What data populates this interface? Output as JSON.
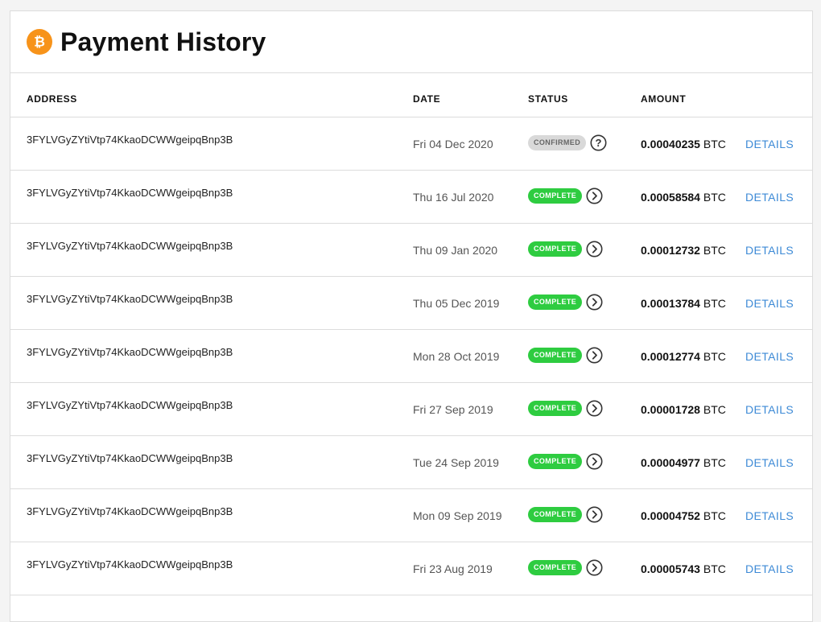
{
  "header": {
    "title": "Payment History",
    "logo_icon": "bitcoin-icon",
    "logo_color": "#f7931a"
  },
  "table": {
    "columns": {
      "address": "ADDRESS",
      "date": "DATE",
      "status": "STATUS",
      "amount": "AMOUNT"
    },
    "details_label": "DETAILS",
    "rows": [
      {
        "address": "3FYLVGyZYtiVtp74KkaoDCWWgeipqBnp3B",
        "date": "Fri 04 Dec 2020",
        "status": "CONFIRMED",
        "status_type": "confirmed",
        "status_icon": "question-circle-icon",
        "amount": "0.00040235",
        "currency": "BTC"
      },
      {
        "address": "3FYLVGyZYtiVtp74KkaoDCWWgeipqBnp3B",
        "date": "Thu 16 Jul 2020",
        "status": "COMPLETE",
        "status_type": "complete",
        "status_icon": "chevron-right-circle-icon",
        "amount": "0.00058584",
        "currency": "BTC"
      },
      {
        "address": "3FYLVGyZYtiVtp74KkaoDCWWgeipqBnp3B",
        "date": "Thu 09 Jan 2020",
        "status": "COMPLETE",
        "status_type": "complete",
        "status_icon": "chevron-right-circle-icon",
        "amount": "0.00012732",
        "currency": "BTC"
      },
      {
        "address": "3FYLVGyZYtiVtp74KkaoDCWWgeipqBnp3B",
        "date": "Thu 05 Dec 2019",
        "status": "COMPLETE",
        "status_type": "complete",
        "status_icon": "chevron-right-circle-icon",
        "amount": "0.00013784",
        "currency": "BTC"
      },
      {
        "address": "3FYLVGyZYtiVtp74KkaoDCWWgeipqBnp3B",
        "date": "Mon 28 Oct 2019",
        "status": "COMPLETE",
        "status_type": "complete",
        "status_icon": "chevron-right-circle-icon",
        "amount": "0.00012774",
        "currency": "BTC"
      },
      {
        "address": "3FYLVGyZYtiVtp74KkaoDCWWgeipqBnp3B",
        "date": "Fri 27 Sep 2019",
        "status": "COMPLETE",
        "status_type": "complete",
        "status_icon": "chevron-right-circle-icon",
        "amount": "0.00001728",
        "currency": "BTC"
      },
      {
        "address": "3FYLVGyZYtiVtp74KkaoDCWWgeipqBnp3B",
        "date": "Tue 24 Sep 2019",
        "status": "COMPLETE",
        "status_type": "complete",
        "status_icon": "chevron-right-circle-icon",
        "amount": "0.00004977",
        "currency": "BTC"
      },
      {
        "address": "3FYLVGyZYtiVtp74KkaoDCWWgeipqBnp3B",
        "date": "Mon 09 Sep 2019",
        "status": "COMPLETE",
        "status_type": "complete",
        "status_icon": "chevron-right-circle-icon",
        "amount": "0.00004752",
        "currency": "BTC"
      },
      {
        "address": "3FYLVGyZYtiVtp74KkaoDCWWgeipqBnp3B",
        "date": "Fri 23 Aug 2019",
        "status": "COMPLETE",
        "status_type": "complete",
        "status_icon": "chevron-right-circle-icon",
        "amount": "0.00005743",
        "currency": "BTC"
      }
    ]
  },
  "colors": {
    "complete": "#2ecc40",
    "confirmed": "#d9d9d9",
    "link": "#3d8ad6"
  }
}
